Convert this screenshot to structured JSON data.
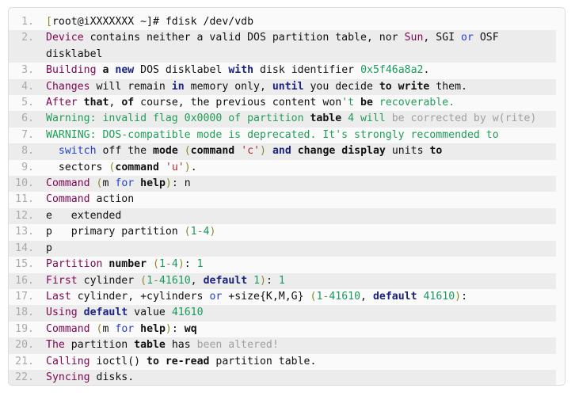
{
  "terminal": {
    "kind": "code-listing",
    "command_context": "fdisk disk partitioning session",
    "line_count": 22,
    "lines": [
      {
        "n": "1.",
        "text": "[root@iXXXXXXX ~]# fdisk /dev/vdb"
      },
      {
        "n": "2.",
        "text": "Device contains neither a valid DOS partition table, nor Sun, SGI or OSF disklabel"
      },
      {
        "n": "3.",
        "text": "Building a new DOS disklabel with disk identifier 0x5f46a8a2."
      },
      {
        "n": "4.",
        "text": "Changes will remain in memory only, until you decide to write them."
      },
      {
        "n": "5.",
        "text": "After that, of course, the previous content won't be recoverable."
      },
      {
        "n": "6.",
        "text": "Warning: invalid flag 0x0000 of partition table 4 will be corrected by w(rite)"
      },
      {
        "n": "7.",
        "text": "WARNING: DOS-compatible mode is deprecated. It's strongly recommended to"
      },
      {
        "n": "8.",
        "text": "  switch off the mode (command 'c') and change display units to"
      },
      {
        "n": "9.",
        "text": "  sectors (command 'u')."
      },
      {
        "n": "10.",
        "text": "Command (m for help): n"
      },
      {
        "n": "11.",
        "text": "Command action"
      },
      {
        "n": "12.",
        "text": "e   extended"
      },
      {
        "n": "13.",
        "text": "p   primary partition (1-4)"
      },
      {
        "n": "14.",
        "text": "p"
      },
      {
        "n": "15.",
        "text": "Partition number (1-4): 1"
      },
      {
        "n": "16.",
        "text": "First cylinder (1-41610, default 1): 1"
      },
      {
        "n": "17.",
        "text": "Last cylinder, +cylinders or +size{K,M,G} (1-41610, default 41610):"
      },
      {
        "n": "18.",
        "text": "Using default value 41610"
      },
      {
        "n": "19.",
        "text": "Command (m for help): wq"
      },
      {
        "n": "20.",
        "text": "The partition table has been altered!"
      },
      {
        "n": "21.",
        "text": "Calling ioctl() to re-read partition table."
      },
      {
        "n": "22.",
        "text": "Syncing disks."
      }
    ],
    "tokens": [
      [
        {
          "c": "t-op",
          "s": "["
        },
        {
          "c": "t-pl",
          "s": "root@iXXXXXXX ~]# fdisk /dev/vdb"
        }
      ],
      [
        {
          "c": "t-kw",
          "s": "Device"
        },
        {
          "c": "t-pl",
          "s": " contains neither a valid DOS partition table, nor "
        },
        {
          "c": "t-kw",
          "s": "Sun"
        },
        {
          "c": "t-pl",
          "s": ", SGI "
        },
        {
          "c": "t-blue",
          "s": "or"
        },
        {
          "c": "t-pl",
          "s": " OSF disklabel"
        }
      ],
      [
        {
          "c": "t-kw",
          "s": "Building"
        },
        {
          "c": "t-pl",
          "s": " "
        },
        {
          "c": "t-b",
          "s": "a"
        },
        {
          "c": "t-pl",
          "s": " "
        },
        {
          "c": "t-bb",
          "s": "new"
        },
        {
          "c": "t-pl",
          "s": " DOS disklabel "
        },
        {
          "c": "t-bb",
          "s": "with"
        },
        {
          "c": "t-pl",
          "s": " disk identifier "
        },
        {
          "c": "t-num",
          "s": "0x5f46a8a2"
        },
        {
          "c": "t-pl",
          "s": "."
        }
      ],
      [
        {
          "c": "t-kw",
          "s": "Changes"
        },
        {
          "c": "t-pl",
          "s": " will remain "
        },
        {
          "c": "t-bb",
          "s": "in"
        },
        {
          "c": "t-pl",
          "s": " memory only, "
        },
        {
          "c": "t-bb",
          "s": "until"
        },
        {
          "c": "t-pl",
          "s": " you decide "
        },
        {
          "c": "t-b",
          "s": "to write"
        },
        {
          "c": "t-pl",
          "s": " them."
        }
      ],
      [
        {
          "c": "t-kw",
          "s": "After"
        },
        {
          "c": "t-pl",
          "s": " "
        },
        {
          "c": "t-b",
          "s": "that"
        },
        {
          "c": "t-pl",
          "s": ", "
        },
        {
          "c": "t-b",
          "s": "of"
        },
        {
          "c": "t-pl",
          "s": " course, the previous content won"
        },
        {
          "c": "t-cmt",
          "s": "'t "
        },
        {
          "c": "t-b",
          "s": "be"
        },
        {
          "c": "t-cmt",
          "s": " recoverable."
        }
      ],
      [
        {
          "c": "t-cmt",
          "s": "Warning: invalid flag 0x0000 of partition "
        },
        {
          "c": "t-b",
          "s": "table"
        },
        {
          "c": "t-cmt",
          "s": " 4 will "
        },
        {
          "c": "t-gray",
          "s": "be corrected by w(rite)"
        }
      ],
      [
        {
          "c": "t-cmt",
          "s": "WARNING: DOS-compatible mode is deprecated. It's strongly recommended to"
        }
      ],
      [
        {
          "c": "t-pl",
          "s": "  "
        },
        {
          "c": "t-blue",
          "s": "switch"
        },
        {
          "c": "t-pl",
          "s": " off the "
        },
        {
          "c": "t-b",
          "s": "mode"
        },
        {
          "c": "t-pl",
          "s": " "
        },
        {
          "c": "t-op",
          "s": "("
        },
        {
          "c": "t-b",
          "s": "command"
        },
        {
          "c": "t-pl",
          "s": " "
        },
        {
          "c": "t-str",
          "s": "'c'"
        },
        {
          "c": "t-op",
          "s": ")"
        },
        {
          "c": "t-pl",
          "s": " "
        },
        {
          "c": "t-bb",
          "s": "and"
        },
        {
          "c": "t-pl",
          "s": " "
        },
        {
          "c": "t-b",
          "s": "change display"
        },
        {
          "c": "t-pl",
          "s": " units "
        },
        {
          "c": "t-b",
          "s": "to"
        }
      ],
      [
        {
          "c": "t-pl",
          "s": "  sectors "
        },
        {
          "c": "t-op",
          "s": "("
        },
        {
          "c": "t-b",
          "s": "command"
        },
        {
          "c": "t-pl",
          "s": " "
        },
        {
          "c": "t-str",
          "s": "'u'"
        },
        {
          "c": "t-op",
          "s": ")"
        },
        {
          "c": "t-pl",
          "s": "."
        }
      ],
      [
        {
          "c": "t-kw",
          "s": "Command"
        },
        {
          "c": "t-pl",
          "s": " "
        },
        {
          "c": "t-op",
          "s": "("
        },
        {
          "c": "t-pl",
          "s": "m "
        },
        {
          "c": "t-blue",
          "s": "for"
        },
        {
          "c": "t-pl",
          "s": " "
        },
        {
          "c": "t-b",
          "s": "help"
        },
        {
          "c": "t-op",
          "s": ")"
        },
        {
          "c": "t-pl",
          "s": ": n"
        }
      ],
      [
        {
          "c": "t-kw",
          "s": "Command"
        },
        {
          "c": "t-pl",
          "s": " action"
        }
      ],
      [
        {
          "c": "t-pl",
          "s": "e   extended"
        }
      ],
      [
        {
          "c": "t-pl",
          "s": "p   primary partition "
        },
        {
          "c": "t-op",
          "s": "("
        },
        {
          "c": "t-num",
          "s": "1"
        },
        {
          "c": "t-op",
          "s": "-"
        },
        {
          "c": "t-num",
          "s": "4"
        },
        {
          "c": "t-op",
          "s": ")"
        }
      ],
      [
        {
          "c": "t-pl",
          "s": "p"
        }
      ],
      [
        {
          "c": "t-kw",
          "s": "Partition"
        },
        {
          "c": "t-pl",
          "s": " "
        },
        {
          "c": "t-b",
          "s": "number"
        },
        {
          "c": "t-pl",
          "s": " "
        },
        {
          "c": "t-op",
          "s": "("
        },
        {
          "c": "t-num",
          "s": "1"
        },
        {
          "c": "t-op",
          "s": "-"
        },
        {
          "c": "t-num",
          "s": "4"
        },
        {
          "c": "t-op",
          "s": ")"
        },
        {
          "c": "t-pl",
          "s": ": "
        },
        {
          "c": "t-num",
          "s": "1"
        }
      ],
      [
        {
          "c": "t-kw",
          "s": "First"
        },
        {
          "c": "t-pl",
          "s": " cylinder "
        },
        {
          "c": "t-op",
          "s": "("
        },
        {
          "c": "t-num",
          "s": "1"
        },
        {
          "c": "t-op",
          "s": "-"
        },
        {
          "c": "t-num",
          "s": "41610"
        },
        {
          "c": "t-pl",
          "s": ", "
        },
        {
          "c": "t-bb",
          "s": "default"
        },
        {
          "c": "t-pl",
          "s": " "
        },
        {
          "c": "t-num",
          "s": "1"
        },
        {
          "c": "t-op",
          "s": ")"
        },
        {
          "c": "t-pl",
          "s": ": "
        },
        {
          "c": "t-num",
          "s": "1"
        }
      ],
      [
        {
          "c": "t-kw",
          "s": "Last"
        },
        {
          "c": "t-pl",
          "s": " cylinder, +cylinders "
        },
        {
          "c": "t-blue",
          "s": "or"
        },
        {
          "c": "t-pl",
          "s": " +size{K,M,G} "
        },
        {
          "c": "t-op",
          "s": "("
        },
        {
          "c": "t-num",
          "s": "1"
        },
        {
          "c": "t-op",
          "s": "-"
        },
        {
          "c": "t-num",
          "s": "41610"
        },
        {
          "c": "t-pl",
          "s": ", "
        },
        {
          "c": "t-bb",
          "s": "default"
        },
        {
          "c": "t-pl",
          "s": " "
        },
        {
          "c": "t-num",
          "s": "41610"
        },
        {
          "c": "t-op",
          "s": ")"
        },
        {
          "c": "t-pl",
          "s": ":"
        }
      ],
      [
        {
          "c": "t-kw",
          "s": "Using"
        },
        {
          "c": "t-pl",
          "s": " "
        },
        {
          "c": "t-bb",
          "s": "default"
        },
        {
          "c": "t-pl",
          "s": " value "
        },
        {
          "c": "t-num",
          "s": "41610"
        }
      ],
      [
        {
          "c": "t-kw",
          "s": "Command"
        },
        {
          "c": "t-pl",
          "s": " "
        },
        {
          "c": "t-op",
          "s": "("
        },
        {
          "c": "t-pl",
          "s": "m "
        },
        {
          "c": "t-blue",
          "s": "for"
        },
        {
          "c": "t-pl",
          "s": " "
        },
        {
          "c": "t-b",
          "s": "help"
        },
        {
          "c": "t-op",
          "s": ")"
        },
        {
          "c": "t-pl",
          "s": ": "
        },
        {
          "c": "t-b",
          "s": "wq"
        }
      ],
      [
        {
          "c": "t-kw",
          "s": "The"
        },
        {
          "c": "t-pl",
          "s": " partition "
        },
        {
          "c": "t-b",
          "s": "table"
        },
        {
          "c": "t-pl",
          "s": " has "
        },
        {
          "c": "t-gray",
          "s": "been altered!"
        }
      ],
      [
        {
          "c": "t-kw",
          "s": "Calling"
        },
        {
          "c": "t-pl",
          "s": " ioctl() "
        },
        {
          "c": "t-b",
          "s": "to re-read"
        },
        {
          "c": "t-pl",
          "s": " partition table."
        }
      ],
      [
        {
          "c": "t-kw",
          "s": "Syncing"
        },
        {
          "c": "t-pl",
          "s": " disks."
        }
      ]
    ],
    "colors": {
      "background": "#fafafa",
      "stripe": "#ececec",
      "border": "#dcdcdc",
      "line_number": "#aaaaaa",
      "plain_text": "#111111",
      "keyword_purple": "#7d0552",
      "keyword_blue": "#1a237e",
      "link_blue": "#2341c9",
      "number_green": "#1a9a5f",
      "comment_green": "#1f9d55",
      "string_red": "#b02a2a",
      "punctuation_olive": "#8a8a28",
      "muted_gray": "#a0a0a0"
    }
  }
}
